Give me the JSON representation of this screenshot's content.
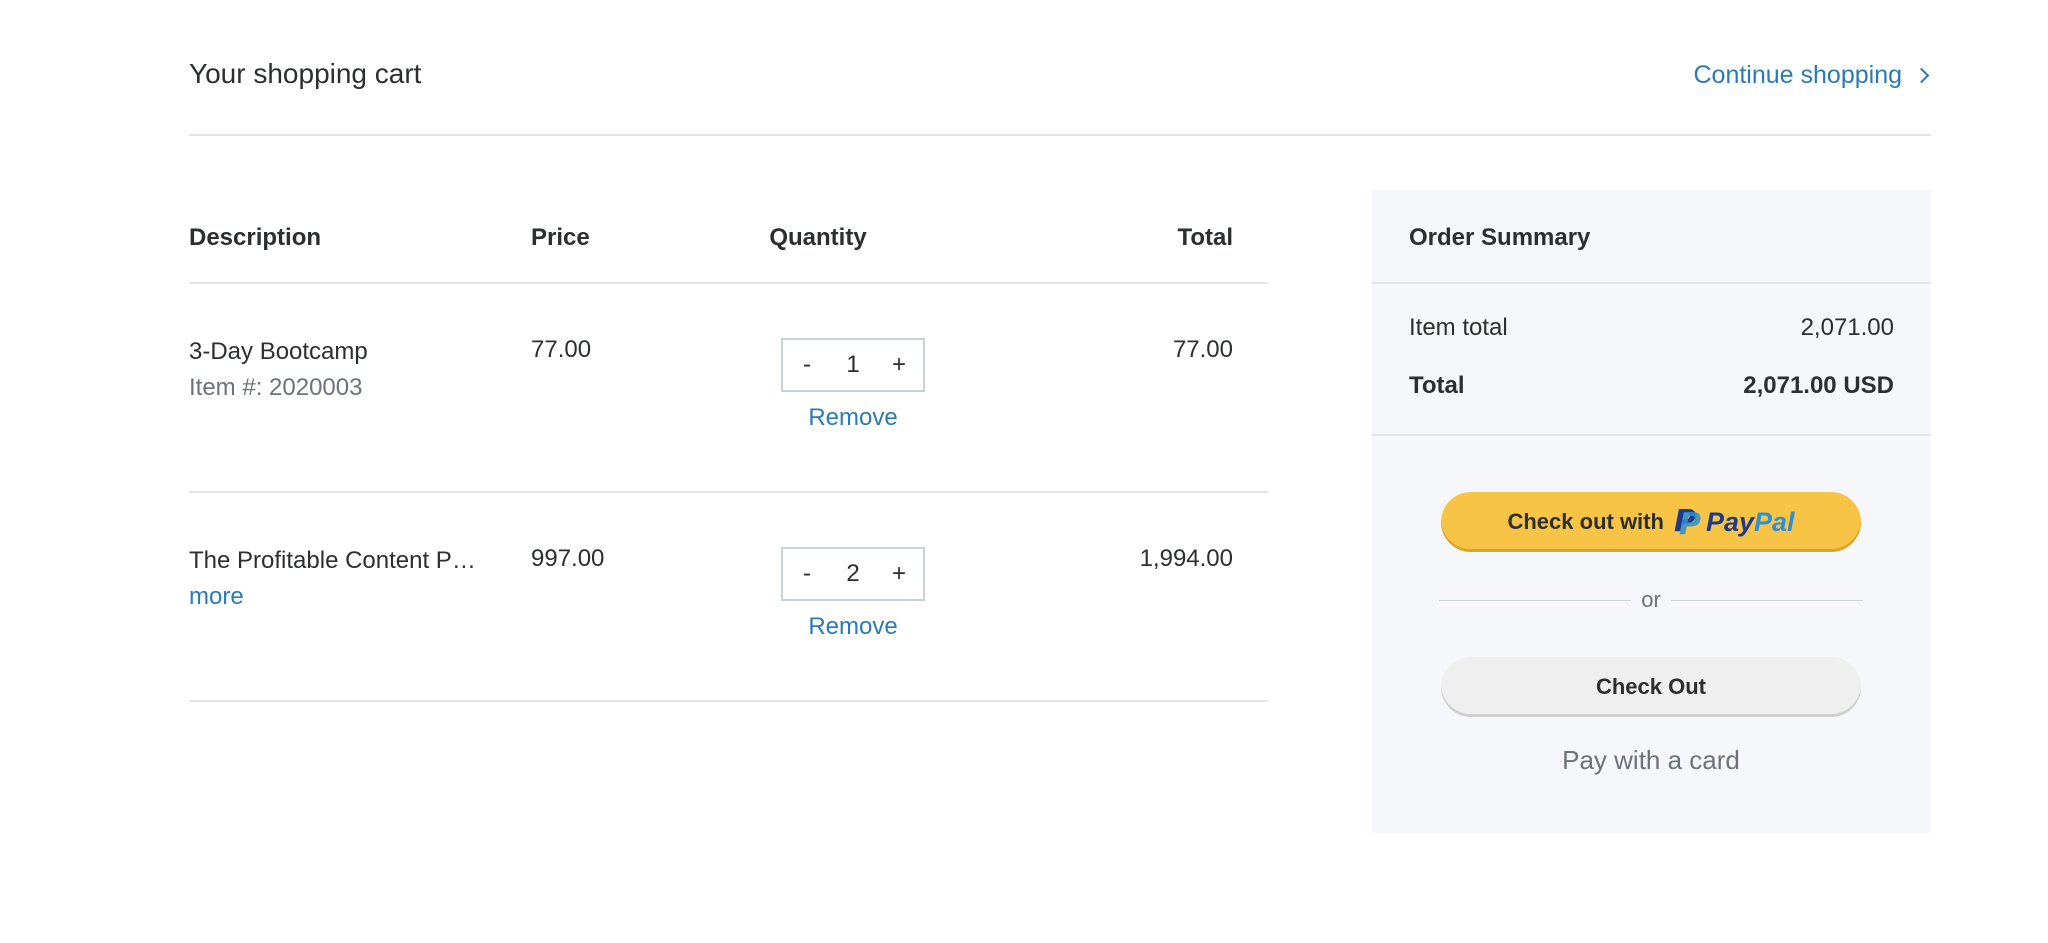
{
  "header": {
    "title": "Your shopping cart",
    "continue_label": "Continue shopping"
  },
  "table": {
    "columns": [
      "Description",
      "Price",
      "Quantity",
      "Total"
    ],
    "rows": [
      {
        "name": "3-Day Bootcamp",
        "sub": "Item #: 2020003",
        "price": "77.00",
        "quantity": "1",
        "total": "77.00",
        "remove_label": "Remove"
      },
      {
        "name": "The Profitable Content P…",
        "more_label": "more",
        "price": "997.00",
        "quantity": "2",
        "total": "1,994.00",
        "remove_label": "Remove"
      }
    ],
    "decrement_label": "-",
    "increment_label": "+"
  },
  "summary": {
    "title": "Order Summary",
    "item_total_label": "Item total",
    "item_total_value": "2,071.00",
    "total_label": "Total",
    "total_value": "2,071.00 USD",
    "paypal_prefix": "Check out with",
    "paypal_word_pay": "Pay",
    "paypal_word_pal": "Pal",
    "paypal_mark": "P",
    "or_label": "or",
    "checkout_label": "Check Out",
    "card_label": "Pay with a card"
  },
  "colors": {
    "link": "#2a7ab8",
    "paypal_button": "#f7c445",
    "summary_bg": "#f5f7fa"
  }
}
